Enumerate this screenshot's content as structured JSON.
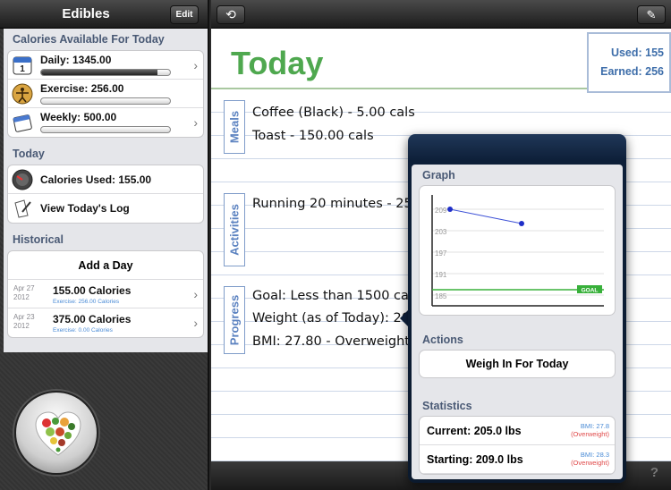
{
  "sidebar": {
    "title": "Edibles",
    "edit_label": "Edit",
    "available_header": "Calories Available For Today",
    "available": [
      {
        "label": "Daily: 1345.00",
        "progress": 0.9,
        "icon": "calendar-icon"
      },
      {
        "label": "Exercise: 256.00",
        "progress": 0.0,
        "icon": "vitruvian-man-icon"
      },
      {
        "label": "Weekly: 500.00",
        "progress": 0.0,
        "icon": "weekly-calendar-icon"
      }
    ],
    "today_header": "Today",
    "today_items": [
      {
        "label": "Calories Used: 155.00",
        "icon": "gauge-icon"
      },
      {
        "label": "View Today's Log",
        "icon": "log-icon"
      }
    ],
    "historical_header": "Historical",
    "add_day_label": "Add a Day",
    "history": [
      {
        "date_line1": "Apr 27",
        "date_line2": "2012",
        "calories": "155.00 Calories",
        "exercise": "Exercise: 256.00 Calories"
      },
      {
        "date_line1": "Apr 23",
        "date_line2": "2012",
        "calories": "375.00 Calories",
        "exercise": "Exercise: 0.00 Calories"
      }
    ]
  },
  "main": {
    "title": "Today",
    "used": "Used: 155",
    "earned": "Earned: 256",
    "meals_tag": "Meals",
    "meals": [
      "Coffee (Black) - 5.00 cals",
      "Toast - 150.00 cals"
    ],
    "activities_tag": "Activities",
    "activities": [
      "Running 20 minutes - 256"
    ],
    "progress_tag": "Progress",
    "progress": [
      "Goal: Less than 1500 cals",
      "Weight (as of Today): 205",
      "BMI: 27.80 - Overweight"
    ],
    "help": "?"
  },
  "popover": {
    "graph_header": "Graph",
    "actions_header": "Actions",
    "weigh_in_label": "Weigh In For Today",
    "statistics_header": "Statistics",
    "stats": [
      {
        "label": "Current: 205.0 lbs",
        "bmi": "BMI: 27.8",
        "status": "(Overweight)"
      },
      {
        "label": "Starting: 209.0 lbs",
        "bmi": "BMI: 28.3",
        "status": "(Overweight)"
      }
    ]
  },
  "chart_data": {
    "type": "line",
    "y_ticks": [
      "209",
      "203",
      "197",
      "191",
      "185"
    ],
    "ylim": [
      182,
      213
    ],
    "series": [
      {
        "values": [
          209.0,
          205.0
        ]
      }
    ],
    "goal_label": "GOAL",
    "goal_value": 186.5,
    "colors": {
      "line": "#3b4fd6",
      "goal": "#38b03a"
    }
  }
}
